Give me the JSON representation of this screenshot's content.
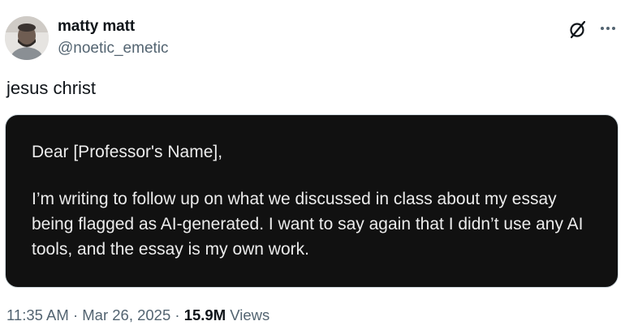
{
  "author": {
    "display_name": "matty matt",
    "handle": "@noetic_emetic"
  },
  "icons": {
    "grok": "grok-icon",
    "more": "more-options-icon"
  },
  "tweet": {
    "text": "jesus christ"
  },
  "media": {
    "greeting": "Dear [Professor's Name],",
    "body": "I’m writing to follow up on what we discussed in class about my essay being flagged as AI-generated. I want to say again that I didn’t use any AI tools, and the essay is my own work."
  },
  "meta": {
    "time": "11:35 AM",
    "separator": "·",
    "date": "Mar 26, 2025",
    "views_count": "15.9M",
    "views_label": "Views"
  },
  "colors": {
    "text_primary": "#0f1419",
    "text_secondary": "#536471",
    "media_background": "#111111",
    "media_text": "#ececec"
  }
}
